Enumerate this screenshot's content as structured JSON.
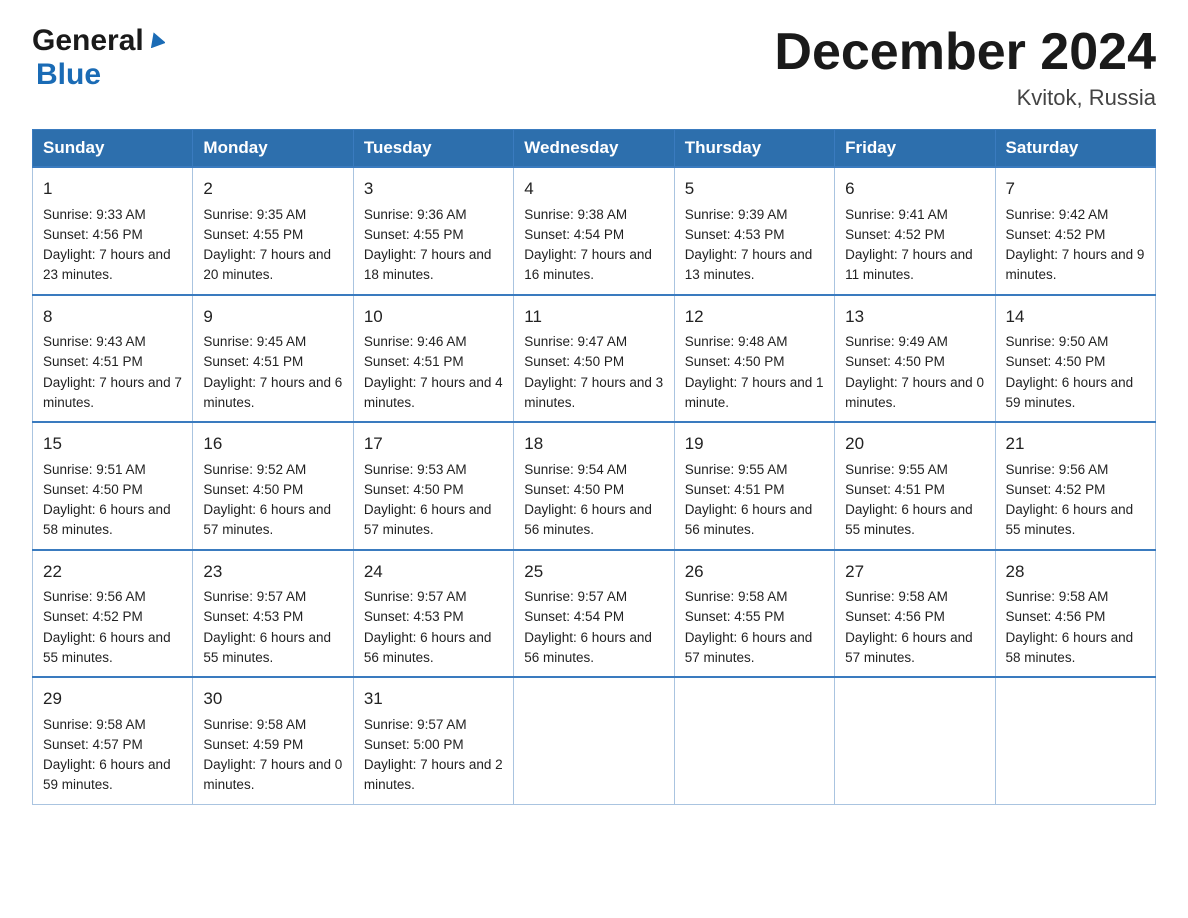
{
  "logo": {
    "general": "General",
    "blue": "Blue"
  },
  "title": "December 2024",
  "location": "Kvitok, Russia",
  "days_of_week": [
    "Sunday",
    "Monday",
    "Tuesday",
    "Wednesday",
    "Thursday",
    "Friday",
    "Saturday"
  ],
  "weeks": [
    [
      {
        "day": "1",
        "sunrise": "9:33 AM",
        "sunset": "4:56 PM",
        "daylight": "7 hours and 23 minutes."
      },
      {
        "day": "2",
        "sunrise": "9:35 AM",
        "sunset": "4:55 PM",
        "daylight": "7 hours and 20 minutes."
      },
      {
        "day": "3",
        "sunrise": "9:36 AM",
        "sunset": "4:55 PM",
        "daylight": "7 hours and 18 minutes."
      },
      {
        "day": "4",
        "sunrise": "9:38 AM",
        "sunset": "4:54 PM",
        "daylight": "7 hours and 16 minutes."
      },
      {
        "day": "5",
        "sunrise": "9:39 AM",
        "sunset": "4:53 PM",
        "daylight": "7 hours and 13 minutes."
      },
      {
        "day": "6",
        "sunrise": "9:41 AM",
        "sunset": "4:52 PM",
        "daylight": "7 hours and 11 minutes."
      },
      {
        "day": "7",
        "sunrise": "9:42 AM",
        "sunset": "4:52 PM",
        "daylight": "7 hours and 9 minutes."
      }
    ],
    [
      {
        "day": "8",
        "sunrise": "9:43 AM",
        "sunset": "4:51 PM",
        "daylight": "7 hours and 7 minutes."
      },
      {
        "day": "9",
        "sunrise": "9:45 AM",
        "sunset": "4:51 PM",
        "daylight": "7 hours and 6 minutes."
      },
      {
        "day": "10",
        "sunrise": "9:46 AM",
        "sunset": "4:51 PM",
        "daylight": "7 hours and 4 minutes."
      },
      {
        "day": "11",
        "sunrise": "9:47 AM",
        "sunset": "4:50 PM",
        "daylight": "7 hours and 3 minutes."
      },
      {
        "day": "12",
        "sunrise": "9:48 AM",
        "sunset": "4:50 PM",
        "daylight": "7 hours and 1 minute."
      },
      {
        "day": "13",
        "sunrise": "9:49 AM",
        "sunset": "4:50 PM",
        "daylight": "7 hours and 0 minutes."
      },
      {
        "day": "14",
        "sunrise": "9:50 AM",
        "sunset": "4:50 PM",
        "daylight": "6 hours and 59 minutes."
      }
    ],
    [
      {
        "day": "15",
        "sunrise": "9:51 AM",
        "sunset": "4:50 PM",
        "daylight": "6 hours and 58 minutes."
      },
      {
        "day": "16",
        "sunrise": "9:52 AM",
        "sunset": "4:50 PM",
        "daylight": "6 hours and 57 minutes."
      },
      {
        "day": "17",
        "sunrise": "9:53 AM",
        "sunset": "4:50 PM",
        "daylight": "6 hours and 57 minutes."
      },
      {
        "day": "18",
        "sunrise": "9:54 AM",
        "sunset": "4:50 PM",
        "daylight": "6 hours and 56 minutes."
      },
      {
        "day": "19",
        "sunrise": "9:55 AM",
        "sunset": "4:51 PM",
        "daylight": "6 hours and 56 minutes."
      },
      {
        "day": "20",
        "sunrise": "9:55 AM",
        "sunset": "4:51 PM",
        "daylight": "6 hours and 55 minutes."
      },
      {
        "day": "21",
        "sunrise": "9:56 AM",
        "sunset": "4:52 PM",
        "daylight": "6 hours and 55 minutes."
      }
    ],
    [
      {
        "day": "22",
        "sunrise": "9:56 AM",
        "sunset": "4:52 PM",
        "daylight": "6 hours and 55 minutes."
      },
      {
        "day": "23",
        "sunrise": "9:57 AM",
        "sunset": "4:53 PM",
        "daylight": "6 hours and 55 minutes."
      },
      {
        "day": "24",
        "sunrise": "9:57 AM",
        "sunset": "4:53 PM",
        "daylight": "6 hours and 56 minutes."
      },
      {
        "day": "25",
        "sunrise": "9:57 AM",
        "sunset": "4:54 PM",
        "daylight": "6 hours and 56 minutes."
      },
      {
        "day": "26",
        "sunrise": "9:58 AM",
        "sunset": "4:55 PM",
        "daylight": "6 hours and 57 minutes."
      },
      {
        "day": "27",
        "sunrise": "9:58 AM",
        "sunset": "4:56 PM",
        "daylight": "6 hours and 57 minutes."
      },
      {
        "day": "28",
        "sunrise": "9:58 AM",
        "sunset": "4:56 PM",
        "daylight": "6 hours and 58 minutes."
      }
    ],
    [
      {
        "day": "29",
        "sunrise": "9:58 AM",
        "sunset": "4:57 PM",
        "daylight": "6 hours and 59 minutes."
      },
      {
        "day": "30",
        "sunrise": "9:58 AM",
        "sunset": "4:59 PM",
        "daylight": "7 hours and 0 minutes."
      },
      {
        "day": "31",
        "sunrise": "9:57 AM",
        "sunset": "5:00 PM",
        "daylight": "7 hours and 2 minutes."
      },
      null,
      null,
      null,
      null
    ]
  ]
}
